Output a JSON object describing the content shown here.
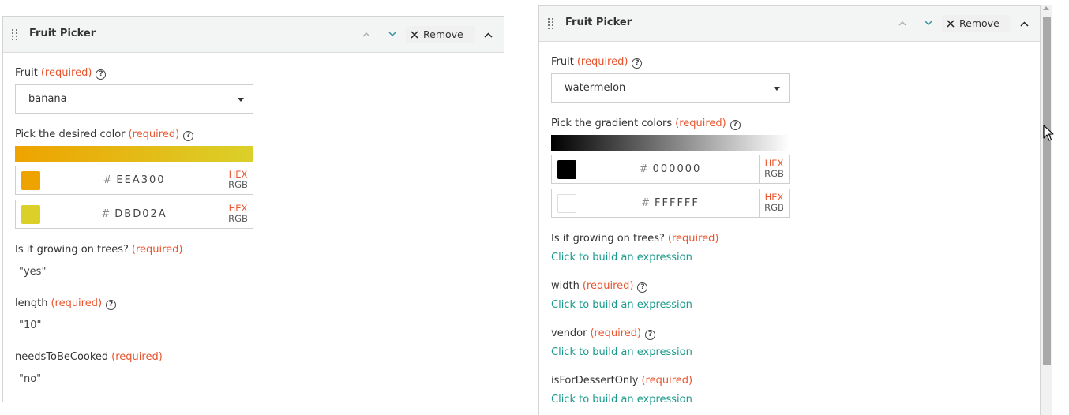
{
  "left_panel": {
    "title": "Fruit Picker",
    "remove_label": "Remove",
    "fruit": {
      "label": "Fruit",
      "required": "(required)",
      "value": "banana"
    },
    "color": {
      "label": "Pick the desired color",
      "required": "(required)",
      "gradient_from": "#EEA300",
      "gradient_to": "#DBD02A",
      "colors": [
        {
          "hex": "EEA300",
          "swatch": "#EEA300"
        },
        {
          "hex": "DBD02A",
          "swatch": "#DBD02A"
        }
      ]
    },
    "trees": {
      "label": "Is it growing on trees?",
      "required": "(required)",
      "value": "\"yes\""
    },
    "length": {
      "label": "length",
      "required": "(required)",
      "value": "\"10\""
    },
    "cooked": {
      "label": "needsToBeCooked",
      "required": "(required)",
      "value": "\"no\""
    }
  },
  "right_panel": {
    "title": "Fruit Picker",
    "remove_label": "Remove",
    "fruit": {
      "label": "Fruit",
      "required": "(required)",
      "value": "watermelon"
    },
    "color": {
      "label": "Pick the gradient colors",
      "required": "(required)",
      "gradient_from": "#000000",
      "gradient_to": "#FFFFFF",
      "colors": [
        {
          "hex": "000000",
          "swatch": "#000000"
        },
        {
          "hex": "FFFFFF",
          "swatch": "#FFFFFF"
        }
      ]
    },
    "trees": {
      "label": "Is it growing on trees?",
      "required": "(required)",
      "link": "Click to build an expression"
    },
    "width": {
      "label": "width",
      "required": "(required)",
      "link": "Click to build an expression"
    },
    "vendor": {
      "label": "vendor",
      "required": "(required)",
      "link": "Click to build an expression"
    },
    "dessert": {
      "label": "isForDessertOnly",
      "required": "(required)",
      "link": "Click to build an expression"
    }
  },
  "color_mode": {
    "hex": "HEX",
    "rgb": "RGB"
  },
  "hash": "#",
  "help_glyph": "?",
  "icons": {
    "drag": "drag-handle-icon",
    "up": "chevron-up-icon",
    "down": "chevron-down-icon",
    "close": "close-icon",
    "collapse": "chevron-up-icon",
    "help": "help-circle-icon",
    "caret": "caret-down-icon"
  },
  "colors": {
    "required": "#e8552e",
    "link": "#1a9a8c",
    "hex_label": "#e8552e"
  }
}
